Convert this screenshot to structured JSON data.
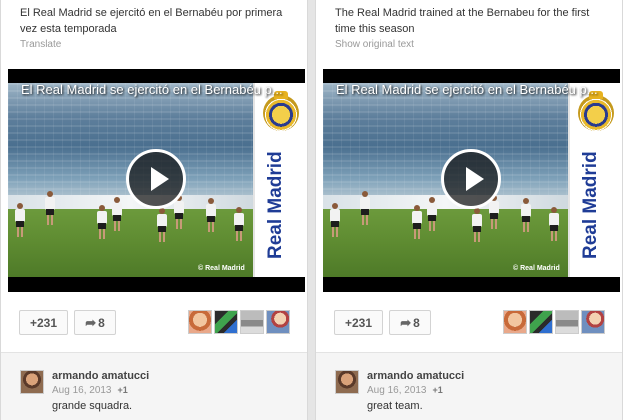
{
  "posts": [
    {
      "text": "El Real Madrid se ejercitó en el Bernabéu por primera vez esta temporada",
      "translate_link": "Translate",
      "video": {
        "title": "El Real Madrid se ejercitó en el Bernabéu p...",
        "brand": "Real Madrid",
        "watermark": "© Real Madrid"
      },
      "plus_count": "+231",
      "share_count": "8",
      "commenter": {
        "name": "armando amatucci",
        "date": "Aug 16, 2013",
        "plus": "+1",
        "comment": "grande squadra."
      }
    },
    {
      "text": "The Real Madrid trained at the Bernabeu for the first time this season",
      "translate_link": "Show original text",
      "video": {
        "title": "El Real Madrid se ejercitó en el Bernabéu p...",
        "brand": "Real Madrid",
        "watermark": "© Real Madrid"
      },
      "plus_count": "+231",
      "share_count": "8",
      "commenter": {
        "name": "armando amatucci",
        "date": "Aug 16, 2013",
        "plus": "+1",
        "comment": "great team."
      }
    }
  ],
  "icons": {
    "play": "play-icon",
    "share": "share-arrow-icon"
  },
  "colors": {
    "brand_blue": "#1f3c96",
    "pitch_green": "#5e8b31",
    "link_gray": "#999999"
  }
}
